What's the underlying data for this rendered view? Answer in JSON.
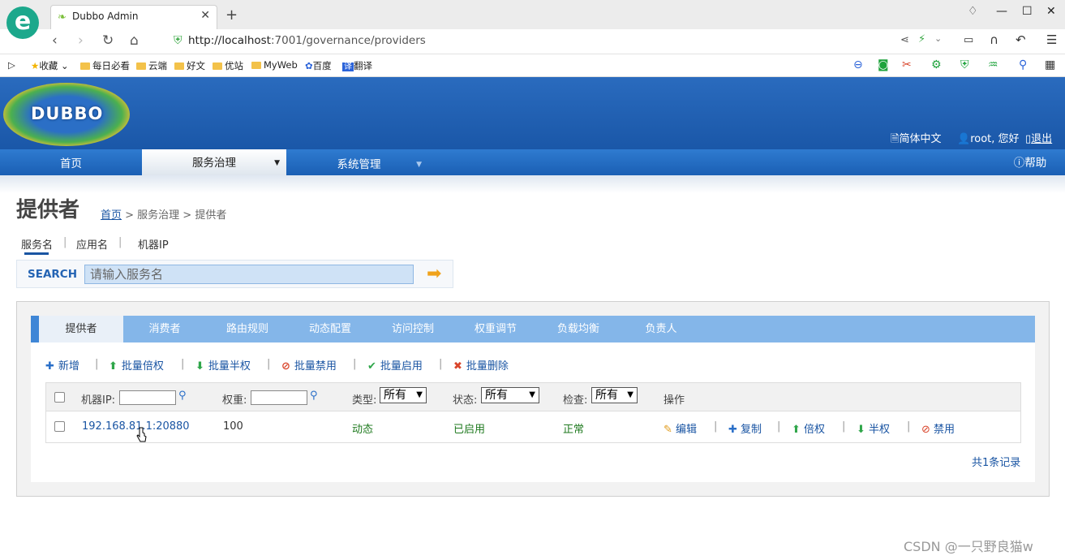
{
  "browser": {
    "tab_title": "Dubbo Admin",
    "url_host": "http://localhost",
    "url_rest": ":7001/governance/providers",
    "bookmarks": [
      "收藏",
      "每日必看",
      "云端",
      "好文",
      "优站",
      "MyWeb",
      "百度",
      "翻译"
    ]
  },
  "header": {
    "logo_text": "DUBBO",
    "lang_link": "简体中文",
    "user_greeting": "root, 您好",
    "logout": "退出",
    "help": "帮助"
  },
  "nav": {
    "items": [
      "首页",
      "服务治理",
      "系统管理"
    ]
  },
  "page": {
    "title": "提供者",
    "breadcrumb_home": "首页",
    "breadcrumb_rest": " > 服务治理 > 提供者",
    "search_tabs": [
      "服务名",
      "应用名",
      "机器IP"
    ],
    "search_label": "SEARCH",
    "search_placeholder": "请输入服务名"
  },
  "panel_tabs": [
    "提供者",
    "消费者",
    "路由规则",
    "动态配置",
    "访问控制",
    "权重调节",
    "负载均衡",
    "负责人"
  ],
  "actions": [
    "新增",
    "批量倍权",
    "批量半权",
    "批量禁用",
    "批量启用",
    "批量删除"
  ],
  "table": {
    "headers": {
      "ip": "机器IP:",
      "weight": "权重:",
      "type": "类型:",
      "status": "状态:",
      "check": "检查:",
      "ops": "操作"
    },
    "filter_all": "所有",
    "rows": [
      {
        "ip": "192.168.81.1:20880",
        "weight": "100",
        "type": "动态",
        "status": "已启用",
        "check": "正常"
      }
    ],
    "row_ops": [
      "编辑",
      "复制",
      "倍权",
      "半权",
      "禁用"
    ],
    "total": "共1条记录"
  },
  "watermark": "CSDN @一只野良猫w"
}
